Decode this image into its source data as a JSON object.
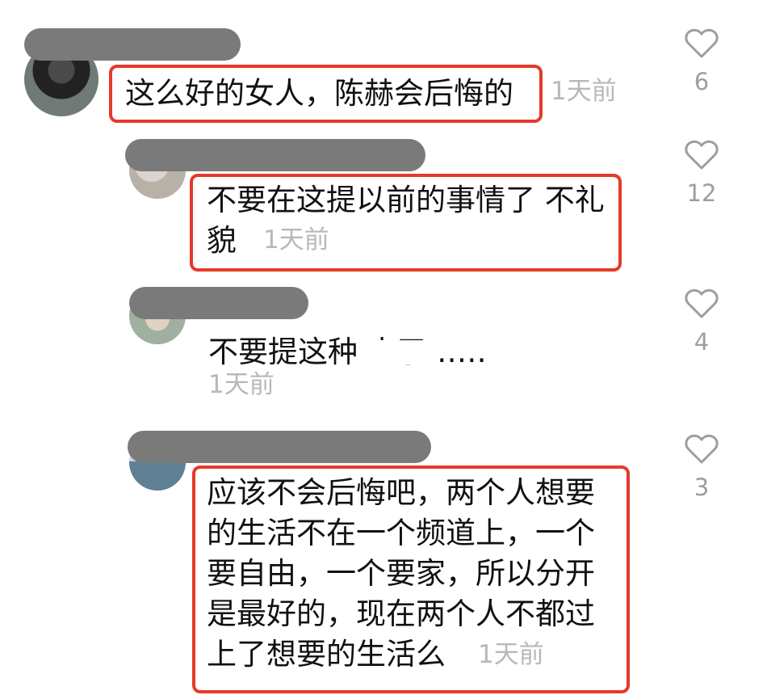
{
  "comments": [
    {
      "text_lines": [
        "这么好的女人，陈赫会后悔的"
      ],
      "time": "1天前",
      "likes": "6"
    },
    {
      "text_lines": [
        "不要在这提以前的事情了 不礼",
        "貌"
      ],
      "time": "1天前",
      "likes": "12"
    },
    {
      "text_lines": [
        "不要提这种 人了……"
      ],
      "time": "1天前",
      "likes": "4"
    },
    {
      "text_lines": [
        "应该不会后悔吧，两个人想要",
        "的生活不在一个频道上，一个",
        "要自由，一个要家，所以分开",
        "是最好的，现在两个人不都过",
        "上了想要的生活么"
      ],
      "time": "1天前",
      "likes": "3"
    }
  ],
  "icons": {
    "like": "heart-outline-icon"
  },
  "colors": {
    "highlight_border": "#e53a2a",
    "timestamp": "#b8b8b8",
    "like_count": "#9e9e9e",
    "blur_name": "#7a7a7a"
  }
}
